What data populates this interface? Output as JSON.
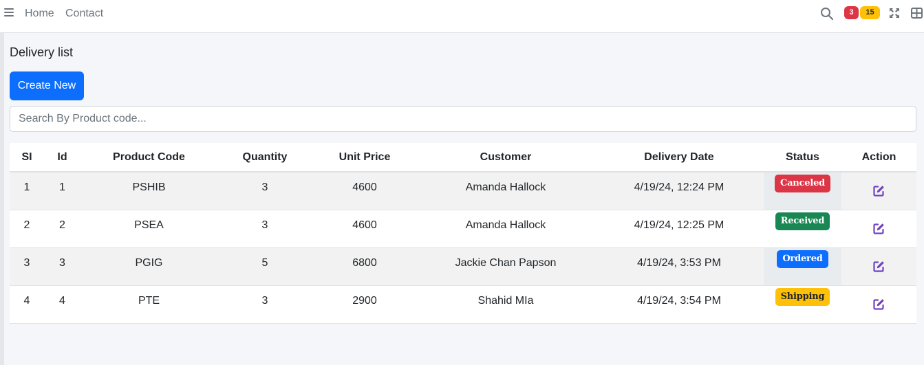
{
  "nav": {
    "home": "Home",
    "contact": "Contact",
    "notifications_count": "3",
    "messages_count": "15",
    "colors": {
      "badge_red": "#dc3545",
      "badge_yellow": "#ffc107"
    }
  },
  "page": {
    "title": "Delivery list",
    "create_button": "Create New",
    "search_placeholder": "Search By Product code..."
  },
  "table": {
    "headers": {
      "si": "SI",
      "id": "Id",
      "product_code": "Product Code",
      "quantity": "Quantity",
      "unit_price": "Unit Price",
      "customer": "Customer",
      "delivery_date": "Delivery Date",
      "status": "Status",
      "action": "Action"
    },
    "rows": [
      {
        "si": "1",
        "id": "1",
        "product_code": "PSHIB",
        "quantity": "3",
        "unit_price": "4600",
        "customer": "Amanda Hallock",
        "delivery_date": "4/19/24, 12:24 PM",
        "status": "Canceled",
        "status_color": "#dc3545",
        "status_text_color": "#ffffff"
      },
      {
        "si": "2",
        "id": "2",
        "product_code": "PSEA",
        "quantity": "3",
        "unit_price": "4600",
        "customer": "Amanda Hallock",
        "delivery_date": "4/19/24, 12:25 PM",
        "status": "Received",
        "status_color": "#198754",
        "status_text_color": "#ffffff"
      },
      {
        "si": "3",
        "id": "3",
        "product_code": "PGIG",
        "quantity": "5",
        "unit_price": "6800",
        "customer": "Jackie Chan Papson",
        "delivery_date": "4/19/24, 3:53 PM",
        "status": "Ordered",
        "status_color": "#0d6efd",
        "status_text_color": "#ffffff"
      },
      {
        "si": "4",
        "id": "4",
        "product_code": "PTE",
        "quantity": "3",
        "unit_price": "2900",
        "customer": "Shahid MIa",
        "delivery_date": "4/19/24, 3:54 PM",
        "status": "Shipping",
        "status_color": "#ffc107",
        "status_text_color": "#212529"
      }
    ],
    "action_icon": "edit-icon",
    "action_icon_color": "#6f42c1"
  }
}
